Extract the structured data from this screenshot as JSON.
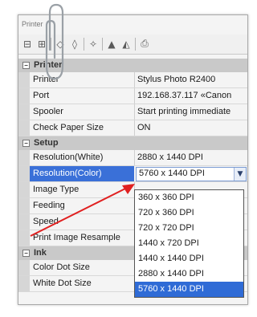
{
  "window": {
    "title": "Printer"
  },
  "toolbar": {
    "icons": [
      "sort-categorized-icon",
      "sort-alphabetical-icon",
      "expand-icon",
      "collapse-icon",
      "property-pages-icon",
      "color-icon",
      "layout-icon",
      "print-icon"
    ]
  },
  "categories": {
    "printer": {
      "label": "Printer",
      "toggle": "−"
    },
    "setup": {
      "label": "Setup",
      "toggle": "−"
    },
    "ink": {
      "label": "Ink",
      "toggle": "−"
    }
  },
  "properties": {
    "printer_name": {
      "label": "Printer",
      "value": "Stylus Photo R2400"
    },
    "port": {
      "label": "Port",
      "value": "192.168.37.117  «Canon"
    },
    "spooler": {
      "label": "Spooler",
      "value": "Start printing immediate"
    },
    "check_paper_size": {
      "label": "Check Paper Size",
      "value": "ON"
    },
    "resolution_white": {
      "label": "Resolution(White)",
      "value": "2880 x 1440 DPI"
    },
    "resolution_color": {
      "label": "Resolution(Color)",
      "value": "5760 x 1440 DPI"
    },
    "image_type": {
      "label": "Image Type",
      "value": ""
    },
    "feeding": {
      "label": "Feeding",
      "value": ""
    },
    "speed": {
      "label": "Speed",
      "value": ""
    },
    "print_image_resample": {
      "label": "Print Image Resample",
      "value": ""
    },
    "color_dot_size": {
      "label": "Color Dot Size",
      "value": ""
    },
    "white_dot_size": {
      "label": "White Dot Size",
      "value": ""
    }
  },
  "resolution_dropdown": {
    "options": [
      "360 x 360 DPI",
      "720 x 360 DPI",
      "720 x 720 DPI",
      "1440 x 720 DPI",
      "1440 x 1440 DPI",
      "2880 x 1440 DPI",
      "5760 x 1440 DPI"
    ],
    "selected": "5760 x 1440 DPI"
  },
  "colors": {
    "selection": "#3a70d8",
    "category_bg": "#c9c9c9",
    "annotation_arrow": "#e02020"
  }
}
